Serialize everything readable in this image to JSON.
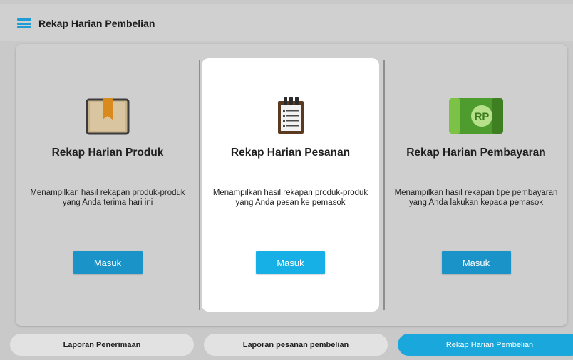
{
  "header": {
    "title": "Rekap Harian Pembelian",
    "menu_icon": "hamburger-menu-icon"
  },
  "cards": [
    {
      "title": "Rekap Harian Produk",
      "description": "Menampilkan hasil rekapan produk-produk yang Anda terima hari ini",
      "button_label": "Masuk",
      "icon": "box-icon",
      "active": false
    },
    {
      "title": "Rekap Harian Pesanan",
      "description": "Menampilkan hasil rekapan produk-produk yang Anda pesan ke pemasok",
      "button_label": "Masuk",
      "icon": "notepad-icon",
      "active": true
    },
    {
      "title": "Rekap Harian Pembayaran",
      "description": "Menampilkan hasil rekapan tipe pembayaran yang Anda lakukan kepada pemasok",
      "button_label": "Masuk",
      "icon": "money-icon",
      "icon_text": "RP",
      "active": false
    }
  ],
  "tabs": [
    {
      "label": "Laporan Penerimaan",
      "active": false
    },
    {
      "label": "Laporan pesanan pembelian",
      "active": false
    },
    {
      "label": "Rekap Harian Pembelian",
      "active": true
    }
  ],
  "colors": {
    "accent": "#1a93c9",
    "accent_active": "#16b0e6",
    "tab_active": "#1aa7dc"
  }
}
